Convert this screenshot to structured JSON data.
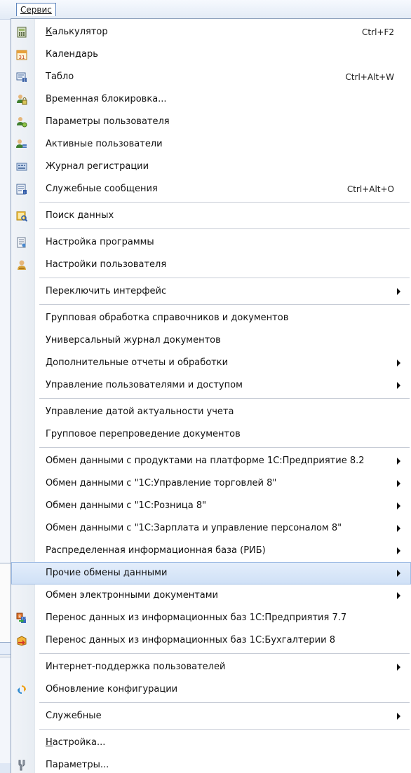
{
  "menubar": {
    "title": "Сервис"
  },
  "menu": {
    "items": [
      {
        "type": "item",
        "label": "Калькулятор",
        "shortcut": "Ctrl+F2",
        "icon": "calculator-icon",
        "underline": true
      },
      {
        "type": "item",
        "label": "Календарь",
        "icon": "calendar-icon"
      },
      {
        "type": "item",
        "label": "Табло",
        "shortcut": "Ctrl+Alt+W",
        "icon": "display-board-icon"
      },
      {
        "type": "item",
        "label": "Временная блокировка...",
        "icon": "lock-users-icon"
      },
      {
        "type": "item",
        "label": "Параметры пользователя",
        "icon": "user-parameters-icon"
      },
      {
        "type": "item",
        "label": "Активные пользователи",
        "icon": "active-users-icon"
      },
      {
        "type": "item",
        "label": "Журнал регистрации",
        "icon": "event-log-icon"
      },
      {
        "type": "item",
        "label": "Служебные сообщения",
        "shortcut": "Ctrl+Alt+O",
        "icon": "service-messages-icon"
      },
      {
        "type": "separator"
      },
      {
        "type": "item",
        "label": "Поиск данных",
        "icon": "data-search-icon"
      },
      {
        "type": "separator"
      },
      {
        "type": "item",
        "label": "Настройка программы",
        "icon": "program-settings-icon"
      },
      {
        "type": "item",
        "label": "Настройки пользователя",
        "icon": "user-settings-icon"
      },
      {
        "type": "separator"
      },
      {
        "type": "item",
        "label": "Переключить интерфейс",
        "submenu": true
      },
      {
        "type": "separator"
      },
      {
        "type": "item",
        "label": "Групповая обработка справочников и документов"
      },
      {
        "type": "item",
        "label": "Универсальный журнал документов"
      },
      {
        "type": "item",
        "label": "Дополнительные отчеты и обработки",
        "submenu": true
      },
      {
        "type": "item",
        "label": "Управление пользователями и доступом",
        "submenu": true
      },
      {
        "type": "separator"
      },
      {
        "type": "item",
        "label": "Управление датой актуальности учета"
      },
      {
        "type": "item",
        "label": "Групповое перепроведение документов"
      },
      {
        "type": "separator"
      },
      {
        "type": "item",
        "label": "Обмен данными с продуктами на платформе 1С:Предприятие 8.2",
        "submenu": true
      },
      {
        "type": "item",
        "label": "Обмен данными с \"1С:Управление торговлей 8\"",
        "submenu": true
      },
      {
        "type": "item",
        "label": "Обмен данными с \"1С:Розница 8\"",
        "submenu": true
      },
      {
        "type": "item",
        "label": "Обмен данными с \"1С:Зарплата и управление персоналом 8\"",
        "submenu": true
      },
      {
        "type": "item",
        "label": "Распределенная информационная база (РИБ)",
        "submenu": true
      },
      {
        "type": "item",
        "label": "Прочие обмены данными",
        "submenu": true,
        "highlighted": true
      },
      {
        "type": "item",
        "label": "Обмен электронными документами",
        "submenu": true
      },
      {
        "type": "item",
        "label": "Перенос данных из информационных баз 1С:Предприятия 7.7",
        "icon": "transfer-77-icon"
      },
      {
        "type": "item",
        "label": "Перенос данных из информационных баз 1С:Бухгалтерии 8",
        "icon": "transfer-accounting-icon"
      },
      {
        "type": "separator"
      },
      {
        "type": "item",
        "label": "Интернет-поддержка пользователей",
        "submenu": true
      },
      {
        "type": "item",
        "label": "Обновление конфигурации",
        "icon": "update-configuration-icon"
      },
      {
        "type": "separator"
      },
      {
        "type": "item",
        "label": "Служебные",
        "submenu": true
      },
      {
        "type": "separator"
      },
      {
        "type": "item",
        "label": "Настройка...",
        "underline": true
      },
      {
        "type": "item",
        "label": "Параметры...",
        "icon": "parameters-icon"
      }
    ]
  }
}
